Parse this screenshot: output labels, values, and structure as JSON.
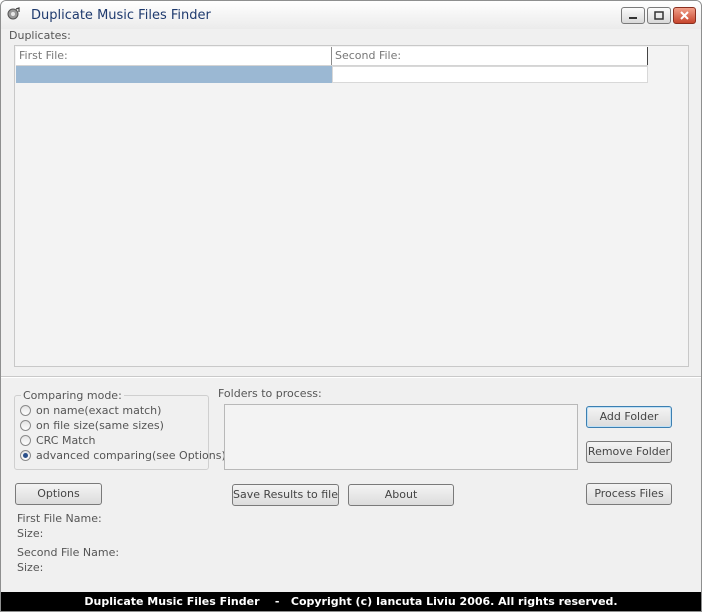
{
  "window": {
    "title": "Duplicate Music Files Finder"
  },
  "duplicates": {
    "label": "Duplicates:",
    "columns": [
      "First File:",
      "Second File:"
    ]
  },
  "comparing_mode": {
    "title": "Comparing mode:",
    "options": [
      {
        "label": "on name(exact match)",
        "checked": false
      },
      {
        "label": "on file size(same sizes)",
        "checked": false
      },
      {
        "label": "CRC Match",
        "checked": false
      },
      {
        "label": "advanced comparing(see Options)",
        "checked": true
      }
    ]
  },
  "folders": {
    "label": "Folders to process:"
  },
  "buttons": {
    "add_folder": "Add Folder",
    "remove_folder": "Remove Folder",
    "process_files": "Process Files",
    "options": "Options",
    "save_results": "Save Results to file",
    "about": "About"
  },
  "file_info": {
    "first_name_label": "First File Name:",
    "first_size_label": "Size:",
    "second_name_label": "Second File Name:",
    "second_size_label": "Size:"
  },
  "status": "Duplicate Music Files Finder    -   Copyright (c) Iancuta Liviu 2006. All rights reserved.",
  "colors": {
    "selected_row": "#9bb8d3",
    "title_text": "#1e3a6e",
    "status_bg": "#000000"
  }
}
